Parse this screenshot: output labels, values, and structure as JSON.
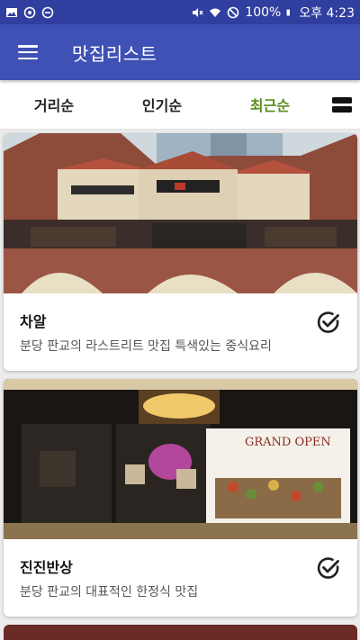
{
  "status": {
    "battery": "100%",
    "time": "오후 4:23"
  },
  "app_bar": {
    "title": "맛집리스트"
  },
  "tabs": [
    {
      "label": "거리순",
      "active": false
    },
    {
      "label": "인기순",
      "active": false
    },
    {
      "label": "최근순",
      "active": true
    }
  ],
  "restaurants": [
    {
      "name": "차알",
      "description": "분당 판교의 라스트리트 맛집 특색있는 중식요리",
      "checked": true
    },
    {
      "name": "진진반상",
      "description": "분당 판교의 대표적인 한정식 맛집",
      "checked": true
    }
  ],
  "photo_texts": {
    "grand_open": "GRAND OPEN"
  },
  "colors": {
    "status_bar": "#303f9f",
    "app_bar": "#3f51b5",
    "active_tab": "#5c8d1e"
  }
}
